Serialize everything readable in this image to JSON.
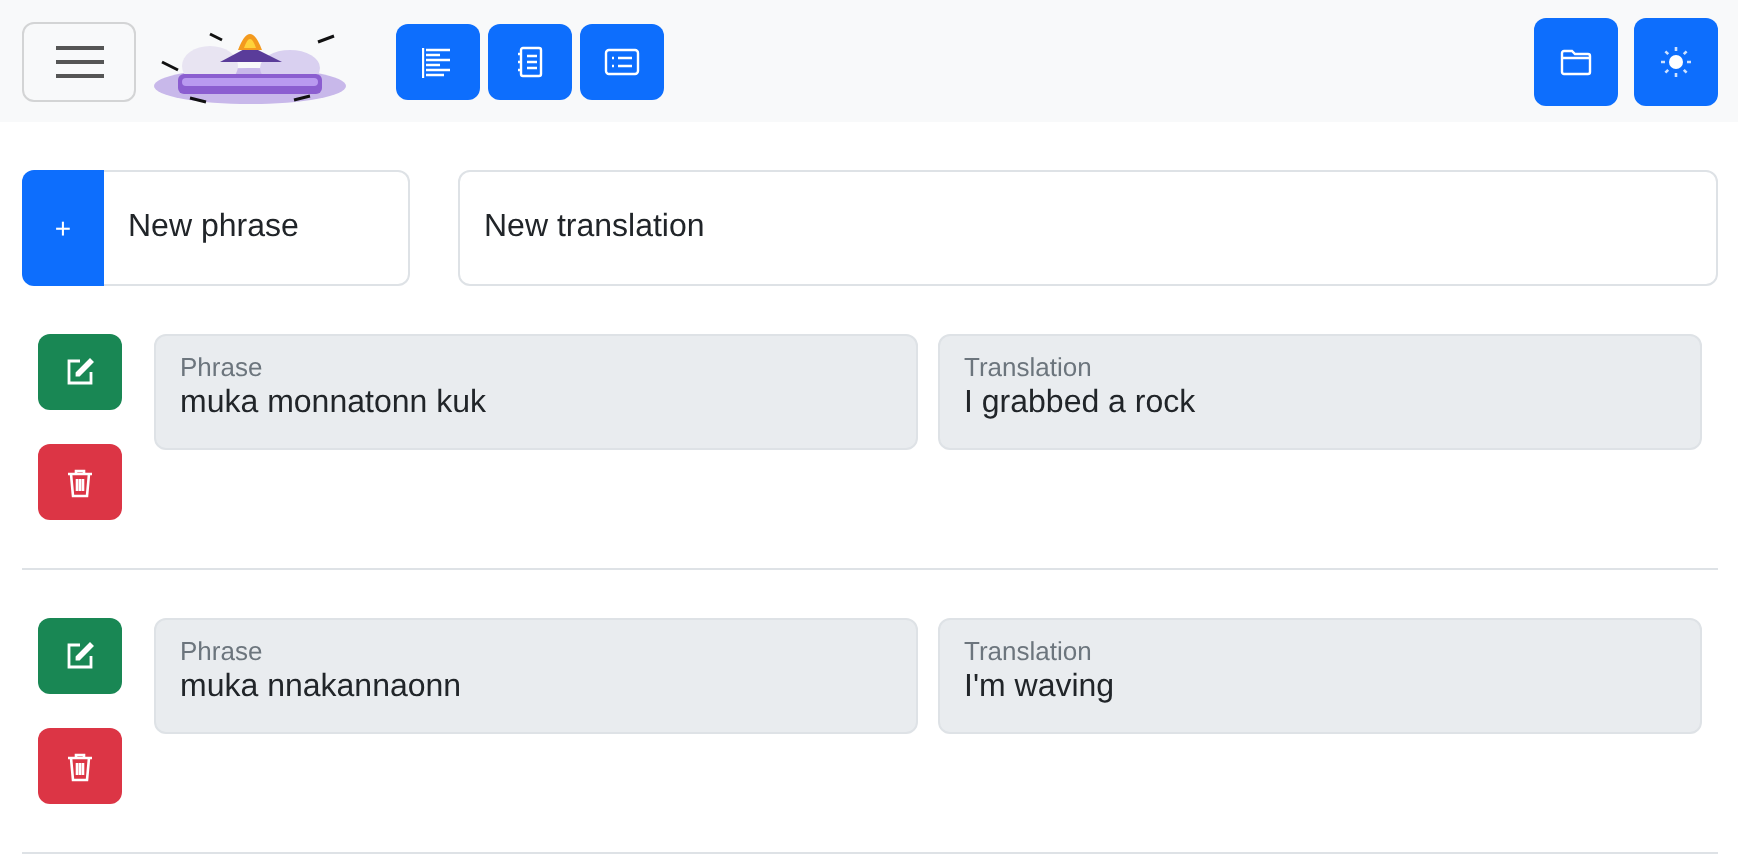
{
  "navbar": {
    "view_buttons": [
      {
        "kind": "list"
      },
      {
        "kind": "notebook"
      },
      {
        "kind": "card"
      }
    ]
  },
  "new_entry": {
    "add_label": "+",
    "phrase_placeholder": "New phrase",
    "translation_placeholder": "New translation"
  },
  "entries": [
    {
      "phrase_label": "Phrase",
      "phrase": "muka monnatonn kuk",
      "translation_label": "Translation",
      "translation": "I grabbed a rock"
    },
    {
      "phrase_label": "Phrase",
      "phrase": "muka nnakannaonn",
      "translation_label": "Translation",
      "translation": "I'm waving"
    }
  ]
}
